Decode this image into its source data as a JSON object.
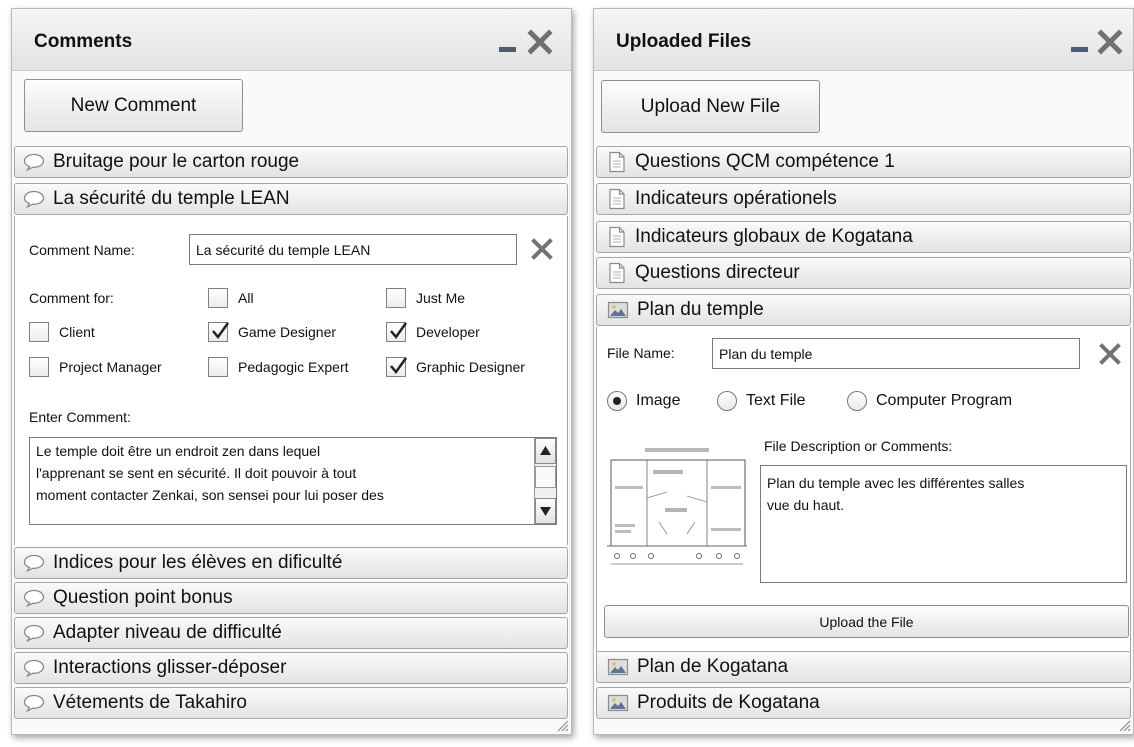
{
  "comments_panel": {
    "title": "Comments",
    "new_button": "New Comment",
    "items_before": [
      "Bruitage pour le carton rouge",
      "La sécurité du temple LEAN"
    ],
    "editor": {
      "name_label": "Comment Name:",
      "name_value": "La sécurité du temple LEAN",
      "for_label": "Comment for:",
      "options": [
        {
          "label": "All",
          "checked": false
        },
        {
          "label": "Just Me",
          "checked": false
        },
        {
          "label": "Client",
          "checked": false
        },
        {
          "label": "Game Designer",
          "checked": true
        },
        {
          "label": "Developer",
          "checked": true
        },
        {
          "label": "Project Manager",
          "checked": false
        },
        {
          "label": "Pedagogic Expert",
          "checked": false
        },
        {
          "label": "Graphic Designer",
          "checked": true
        }
      ],
      "enter_label": "Enter Comment:",
      "comment_lines": [
        "Le temple doit être un endroit zen dans lequel",
        "l'apprenant se sent en sécurité. Il doit pouvoir à tout",
        "moment contacter Zenkai, son sensei pour lui poser des"
      ]
    },
    "items_after": [
      "Indices pour les élèves en dificulté",
      "Question point bonus",
      "Adapter niveau de difficulté",
      "Interactions glisser-déposer",
      "Vétements de Takahiro"
    ]
  },
  "files_panel": {
    "title": "Uploaded Files",
    "upload_button": "Upload New File",
    "items_before": [
      {
        "label": "Questions QCM compétence 1",
        "icon": "document-icon"
      },
      {
        "label": "Indicateurs opérationels",
        "icon": "document-icon"
      },
      {
        "label": "Indicateurs globaux de Kogatana",
        "icon": "document-icon"
      },
      {
        "label": "Questions directeur",
        "icon": "document-icon"
      },
      {
        "label": "Plan du temple",
        "icon": "image-icon"
      }
    ],
    "editor": {
      "name_label": "File Name:",
      "name_value": "Plan du temple",
      "types": [
        {
          "label": "Image",
          "selected": true
        },
        {
          "label": "Text File",
          "selected": false
        },
        {
          "label": "Computer Program",
          "selected": false
        }
      ],
      "desc_label": "File Description or Comments:",
      "desc_lines": [
        "Plan du temple avec les différentes salles",
        "vue du haut."
      ],
      "upload_file_button": "Upload the File"
    },
    "items_after": [
      {
        "label": "Plan de Kogatana",
        "icon": "image-icon"
      },
      {
        "label": "Produits de Kogatana",
        "icon": "image-icon"
      }
    ]
  }
}
